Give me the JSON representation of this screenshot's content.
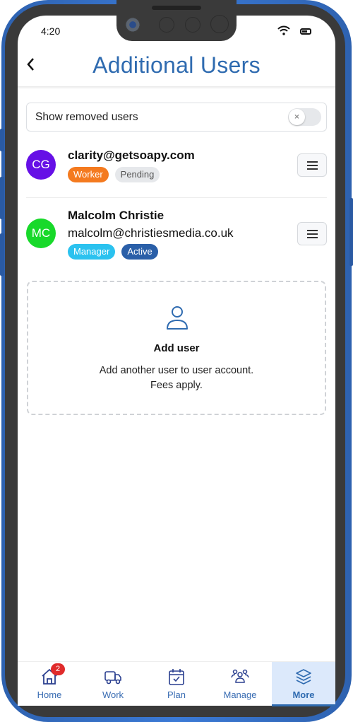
{
  "status_bar": {
    "time": "4:20",
    "icons": [
      "wifi-icon",
      "battery-icon"
    ]
  },
  "header": {
    "back_icon": "chevron-left-icon",
    "title": "Additional Users"
  },
  "toggle": {
    "label": "Show removed users",
    "state": "off",
    "knob_glyph": "×"
  },
  "users": [
    {
      "initials": "CG",
      "avatar_color": "#6610e6",
      "name": "clarity@getsoapy.com",
      "email": "",
      "role": {
        "label": "Worker",
        "bg": "#f47a1f",
        "fg": "#ffffff"
      },
      "status": {
        "label": "Pending",
        "bg": "#e6e8eb",
        "fg": "#555555"
      }
    },
    {
      "initials": "MC",
      "avatar_color": "#18d92a",
      "name": "Malcolm Christie",
      "email": "malcolm@christiesmedia.co.uk",
      "role": {
        "label": "Manager",
        "bg": "#2bc2ef",
        "fg": "#ffffff"
      },
      "status": {
        "label": "Active",
        "bg": "#2a5fa8",
        "fg": "#ffffff"
      }
    }
  ],
  "add_user": {
    "icon": "user-icon",
    "title": "Add user",
    "description_line1": "Add another user to user account.",
    "description_line2": "Fees apply."
  },
  "bottom_nav": {
    "items": [
      {
        "label": "Home",
        "icon": "home-icon",
        "badge": "2",
        "active": false
      },
      {
        "label": "Work",
        "icon": "truck-icon",
        "active": false
      },
      {
        "label": "Plan",
        "icon": "calendar-check-icon",
        "active": false
      },
      {
        "label": "Manage",
        "icon": "users-icon",
        "active": false
      },
      {
        "label": "More",
        "icon": "layers-icon",
        "active": true
      }
    ]
  },
  "colors": {
    "accent": "#2f6bb0",
    "frame": "#3b7ad6",
    "bezel": "#3a3a3a"
  }
}
